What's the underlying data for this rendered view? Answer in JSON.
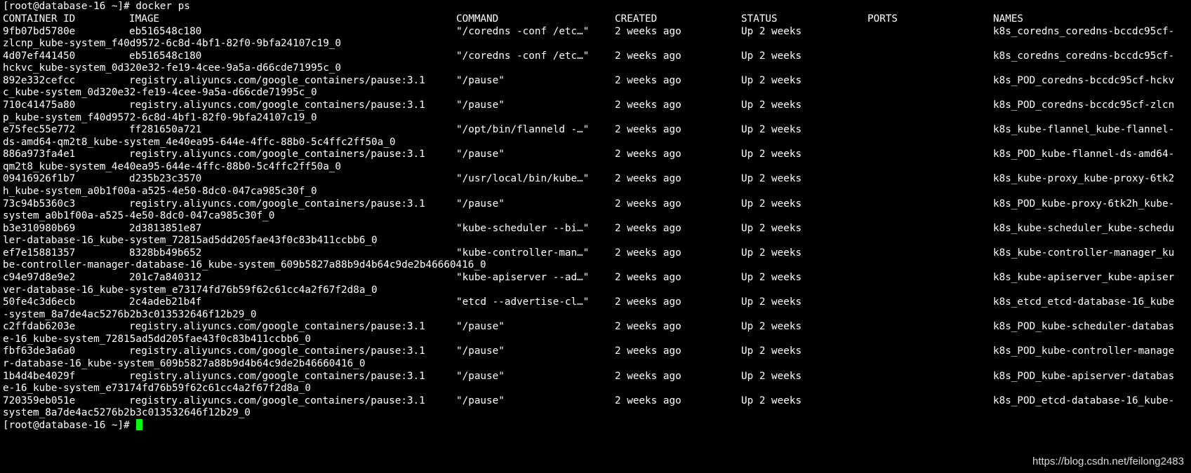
{
  "terminal": {
    "prompt": "[root@database-16 ~]# ",
    "command": "docker ps",
    "final_prompt": "[root@database-16 ~]# ",
    "cursor_color": "#00ff00",
    "background": "#000000",
    "foreground": "#ffffff"
  },
  "table": {
    "headers": {
      "id": "CONTAINER ID",
      "image": "IMAGE",
      "command": "COMMAND",
      "created": "CREATED",
      "status": "STATUS",
      "ports": "PORTS",
      "names": "NAMES"
    },
    "rows": [
      {
        "id": "9fb07bd5780e",
        "image": "eb516548c180",
        "command": "\"/coredns -conf /etc…\"",
        "created": "2 weeks ago",
        "status": "Up 2 weeks",
        "names": "k8s_coredns_coredns-bccdc95cf-",
        "wrap": "zlcnp_kube-system_f40d9572-6c8d-4bf1-82f0-9bfa24107c19_0"
      },
      {
        "id": "4d07ef441450",
        "image": "eb516548c180",
        "command": "\"/coredns -conf /etc…\"",
        "created": "2 weeks ago",
        "status": "Up 2 weeks",
        "names": "k8s_coredns_coredns-bccdc95cf-",
        "wrap": "hckvc_kube-system_0d320e32-fe19-4cee-9a5a-d66cde71995c_0"
      },
      {
        "id": "892e332cefcc",
        "image": "registry.aliyuncs.com/google_containers/pause:3.1",
        "command": "\"/pause\"",
        "created": "2 weeks ago",
        "status": "Up 2 weeks",
        "names": "k8s_POD_coredns-bccdc95cf-hckv",
        "wrap": "c_kube-system_0d320e32-fe19-4cee-9a5a-d66cde71995c_0"
      },
      {
        "id": "710c41475a80",
        "image": "registry.aliyuncs.com/google_containers/pause:3.1",
        "command": "\"/pause\"",
        "created": "2 weeks ago",
        "status": "Up 2 weeks",
        "names": "k8s_POD_coredns-bccdc95cf-zlcn",
        "wrap": "p_kube-system_f40d9572-6c8d-4bf1-82f0-9bfa24107c19_0"
      },
      {
        "id": "e75fec55e772",
        "image": "ff281650a721",
        "command": "\"/opt/bin/flanneld -…\"",
        "created": "2 weeks ago",
        "status": "Up 2 weeks",
        "names": "k8s_kube-flannel_kube-flannel-",
        "wrap": "ds-amd64-qm2t8_kube-system_4e40ea95-644e-4ffc-88b0-5c4ffc2ff50a_0"
      },
      {
        "id": "886a973fa4e1",
        "image": "registry.aliyuncs.com/google_containers/pause:3.1",
        "command": "\"/pause\"",
        "created": "2 weeks ago",
        "status": "Up 2 weeks",
        "names": "k8s_POD_kube-flannel-ds-amd64-",
        "wrap": "qm2t8_kube-system_4e40ea95-644e-4ffc-88b0-5c4ffc2ff50a_0"
      },
      {
        "id": "09416926f1b7",
        "image": "d235b23c3570",
        "command": "\"/usr/local/bin/kube…\"",
        "created": "2 weeks ago",
        "status": "Up 2 weeks",
        "names": "k8s_kube-proxy_kube-proxy-6tk2",
        "wrap": "h_kube-system_a0b1f00a-a525-4e50-8dc0-047ca985c30f_0"
      },
      {
        "id": "73c94b5360c3",
        "image": "registry.aliyuncs.com/google_containers/pause:3.1",
        "command": "\"/pause\"",
        "created": "2 weeks ago",
        "status": "Up 2 weeks",
        "names": "k8s_POD_kube-proxy-6tk2h_kube-",
        "wrap": "system_a0b1f00a-a525-4e50-8dc0-047ca985c30f_0"
      },
      {
        "id": "b3e310980b69",
        "image": "2d3813851e87",
        "command": "\"kube-scheduler --bi…\"",
        "created": "2 weeks ago",
        "status": "Up 2 weeks",
        "names": "k8s_kube-scheduler_kube-schedu",
        "wrap": "ler-database-16_kube-system_72815ad5dd205fae43f0c83b411ccbb6_0"
      },
      {
        "id": "ef7e15881357",
        "image": "8328bb49b652",
        "command": "\"kube-controller-man…\"",
        "created": "2 weeks ago",
        "status": "Up 2 weeks",
        "names": "k8s_kube-controller-manager_ku",
        "wrap": "be-controller-manager-database-16_kube-system_609b5827a88b9d4b64c9de2b46660416_0"
      },
      {
        "id": "c94e97d8e9e2",
        "image": "201c7a840312",
        "command": "\"kube-apiserver --ad…\"",
        "created": "2 weeks ago",
        "status": "Up 2 weeks",
        "names": "k8s_kube-apiserver_kube-apiser",
        "wrap": "ver-database-16_kube-system_e73174fd76b59f62c61cc4a2f67f2d8a_0"
      },
      {
        "id": "50fe4c3d6ecb",
        "image": "2c4adeb21b4f",
        "command": "\"etcd --advertise-cl…\"",
        "created": "2 weeks ago",
        "status": "Up 2 weeks",
        "names": "k8s_etcd_etcd-database-16_kube",
        "wrap": "-system_8a7de4ac5276b2b3c013532646f12b29_0"
      },
      {
        "id": "c2ffdab6203e",
        "image": "registry.aliyuncs.com/google_containers/pause:3.1",
        "command": "\"/pause\"",
        "created": "2 weeks ago",
        "status": "Up 2 weeks",
        "names": "k8s_POD_kube-scheduler-databas",
        "wrap": "e-16_kube-system_72815ad5dd205fae43f0c83b411ccbb6_0"
      },
      {
        "id": "fbf63de3a6a0",
        "image": "registry.aliyuncs.com/google_containers/pause:3.1",
        "command": "\"/pause\"",
        "created": "2 weeks ago",
        "status": "Up 2 weeks",
        "names": "k8s_POD_kube-controller-manage",
        "wrap": "r-database-16_kube-system_609b5827a88b9d4b64c9de2b46660416_0"
      },
      {
        "id": "1b4d4be4029f",
        "image": "registry.aliyuncs.com/google_containers/pause:3.1",
        "command": "\"/pause\"",
        "created": "2 weeks ago",
        "status": "Up 2 weeks",
        "names": "k8s_POD_kube-apiserver-databas",
        "wrap": "e-16_kube-system_e73174fd76b59f62c61cc4a2f67f2d8a_0"
      },
      {
        "id": "720359eb051e",
        "image": "registry.aliyuncs.com/google_containers/pause:3.1",
        "command": "\"/pause\"",
        "created": "2 weeks ago",
        "status": "Up 2 weeks",
        "names": "k8s_POD_etcd-database-16_kube-",
        "wrap": "system_8a7de4ac5276b2b3c013532646f12b29_0"
      }
    ]
  },
  "watermark": "https://blog.csdn.net/feilong2483"
}
